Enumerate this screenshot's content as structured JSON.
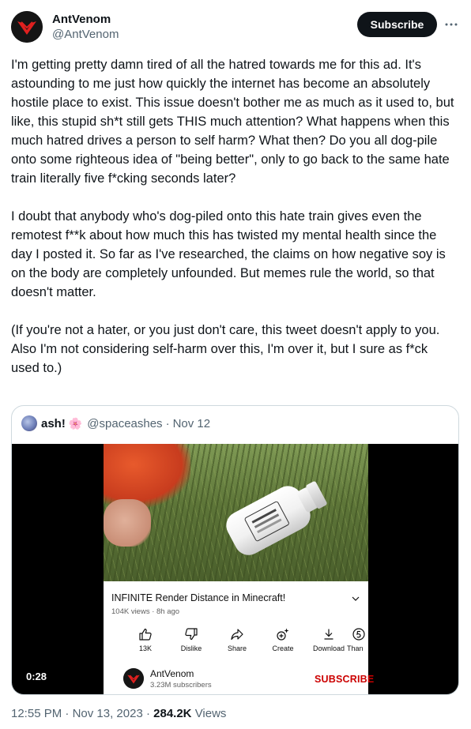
{
  "author": {
    "name": "AntVenom",
    "handle": "@AntVenom"
  },
  "header": {
    "subscribe_label": "Subscribe",
    "more_icon": "more-horizontal-icon"
  },
  "tweet": {
    "paragraphs": [
      "I'm getting pretty damn tired of all the hatred towards me for this ad. It's astounding to me just how quickly the internet has become an absolutely hostile place to exist. This issue doesn't bother me as much as it used to, but like, this stupid sh*t still gets THIS much attention? What happens when this much hatred drives a person to self harm? What then? Do you all dog-pile onto some righteous idea of \"being better\", only to go back to the same hate train literally five f*cking seconds later?",
      "I doubt that anybody who's dog-piled onto this hate train gives even the remotest f**k about how much this has twisted my mental health since the day I posted it. So far as I've researched, the claims on how negative soy is on the body are completely unfounded. But memes rule the world, so that doesn't matter.",
      "(If you're not a hater, or you just don't care, this tweet doesn't apply to you. Also I'm not considering self-harm over this, I'm over it, but I sure as f*ck used to.)"
    ]
  },
  "quote": {
    "name": "ash!",
    "emoji": "🌸",
    "handle": "@spaceashes",
    "separator": "·",
    "date": "Nov 12",
    "video": {
      "duration": "0:28",
      "yt_title": "INFINITE Render Distance in Minecraft!",
      "yt_meta": "104K views · 8h ago",
      "actions": [
        {
          "label": "13K",
          "icon": "thumbs-up-icon"
        },
        {
          "label": "Dislike",
          "icon": "thumbs-down-icon"
        },
        {
          "label": "Share",
          "icon": "share-arrow-icon"
        },
        {
          "label": "Create",
          "icon": "create-sparkle-icon"
        },
        {
          "label": "Download",
          "icon": "download-icon"
        },
        {
          "label": "Than",
          "icon": "thanks-icon"
        }
      ],
      "channel_name": "AntVenom",
      "channel_subs": "3.23M subscribers",
      "channel_subscribe": "SUBSCRIBE"
    }
  },
  "footer": {
    "time": "12:55 PM",
    "sep1": "·",
    "date": "Nov 13, 2023",
    "sep2": "·",
    "views_count": "284.2K",
    "views_label": "Views"
  },
  "colors": {
    "text": "#0f1419",
    "secondary": "#536471",
    "border": "#cfd9de",
    "yt_red": "#cc0000"
  }
}
